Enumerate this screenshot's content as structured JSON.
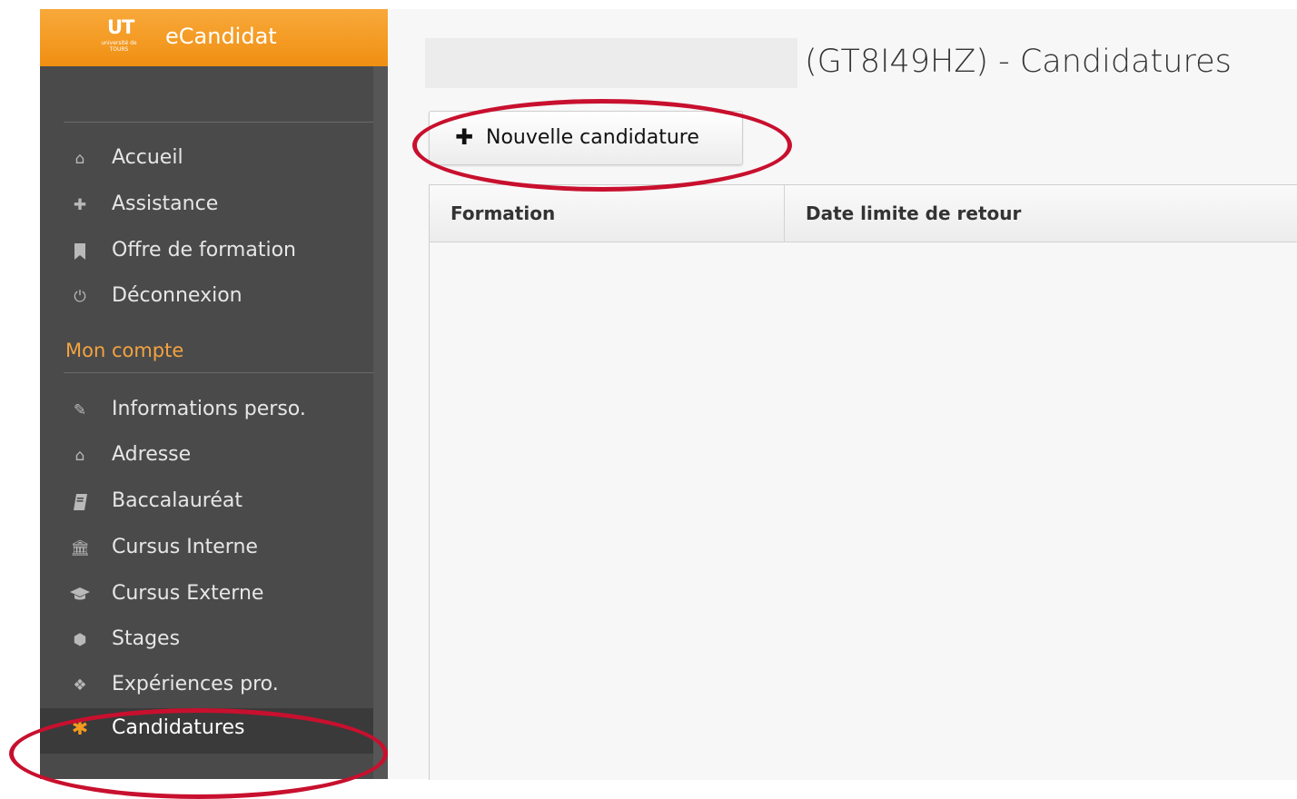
{
  "sidebar": {
    "brand": {
      "logo_text": "UT",
      "logo_subtext": "université de TOURS",
      "title": "eCandidat"
    },
    "nav": [
      {
        "label": "Accueil",
        "icon": "home-icon"
      },
      {
        "label": "Assistance",
        "icon": "ambulance-icon"
      },
      {
        "label": "Offre de formation",
        "icon": "bookmark-icon"
      },
      {
        "label": "Déconnexion",
        "icon": "power-icon"
      }
    ],
    "section_title": "Mon compte",
    "account": [
      {
        "label": "Informations perso.",
        "icon": "pencil-icon"
      },
      {
        "label": "Adresse",
        "icon": "home-icon"
      },
      {
        "label": "Baccalauréat",
        "icon": "book-icon"
      },
      {
        "label": "Cursus Interne",
        "icon": "institution-icon"
      },
      {
        "label": "Cursus Externe",
        "icon": "graduation-cap-icon"
      },
      {
        "label": "Stages",
        "icon": "cube-icon"
      },
      {
        "label": "Expériences pro.",
        "icon": "cubes-icon"
      },
      {
        "label": "Candidatures",
        "icon": "asterisk-icon",
        "active": true
      }
    ]
  },
  "main": {
    "title": "(GT8I49HZ) - Candidatures",
    "new_button_label": "Nouvelle candidature",
    "new_button_icon": "plus-icon",
    "grid": {
      "columns": [
        "Formation",
        "Date limite de retour"
      ],
      "rows": []
    }
  },
  "colors": {
    "brand_orange": "#f39a1f",
    "sidebar_bg": "#4a4a4a",
    "annotation_red": "#c8102e"
  }
}
